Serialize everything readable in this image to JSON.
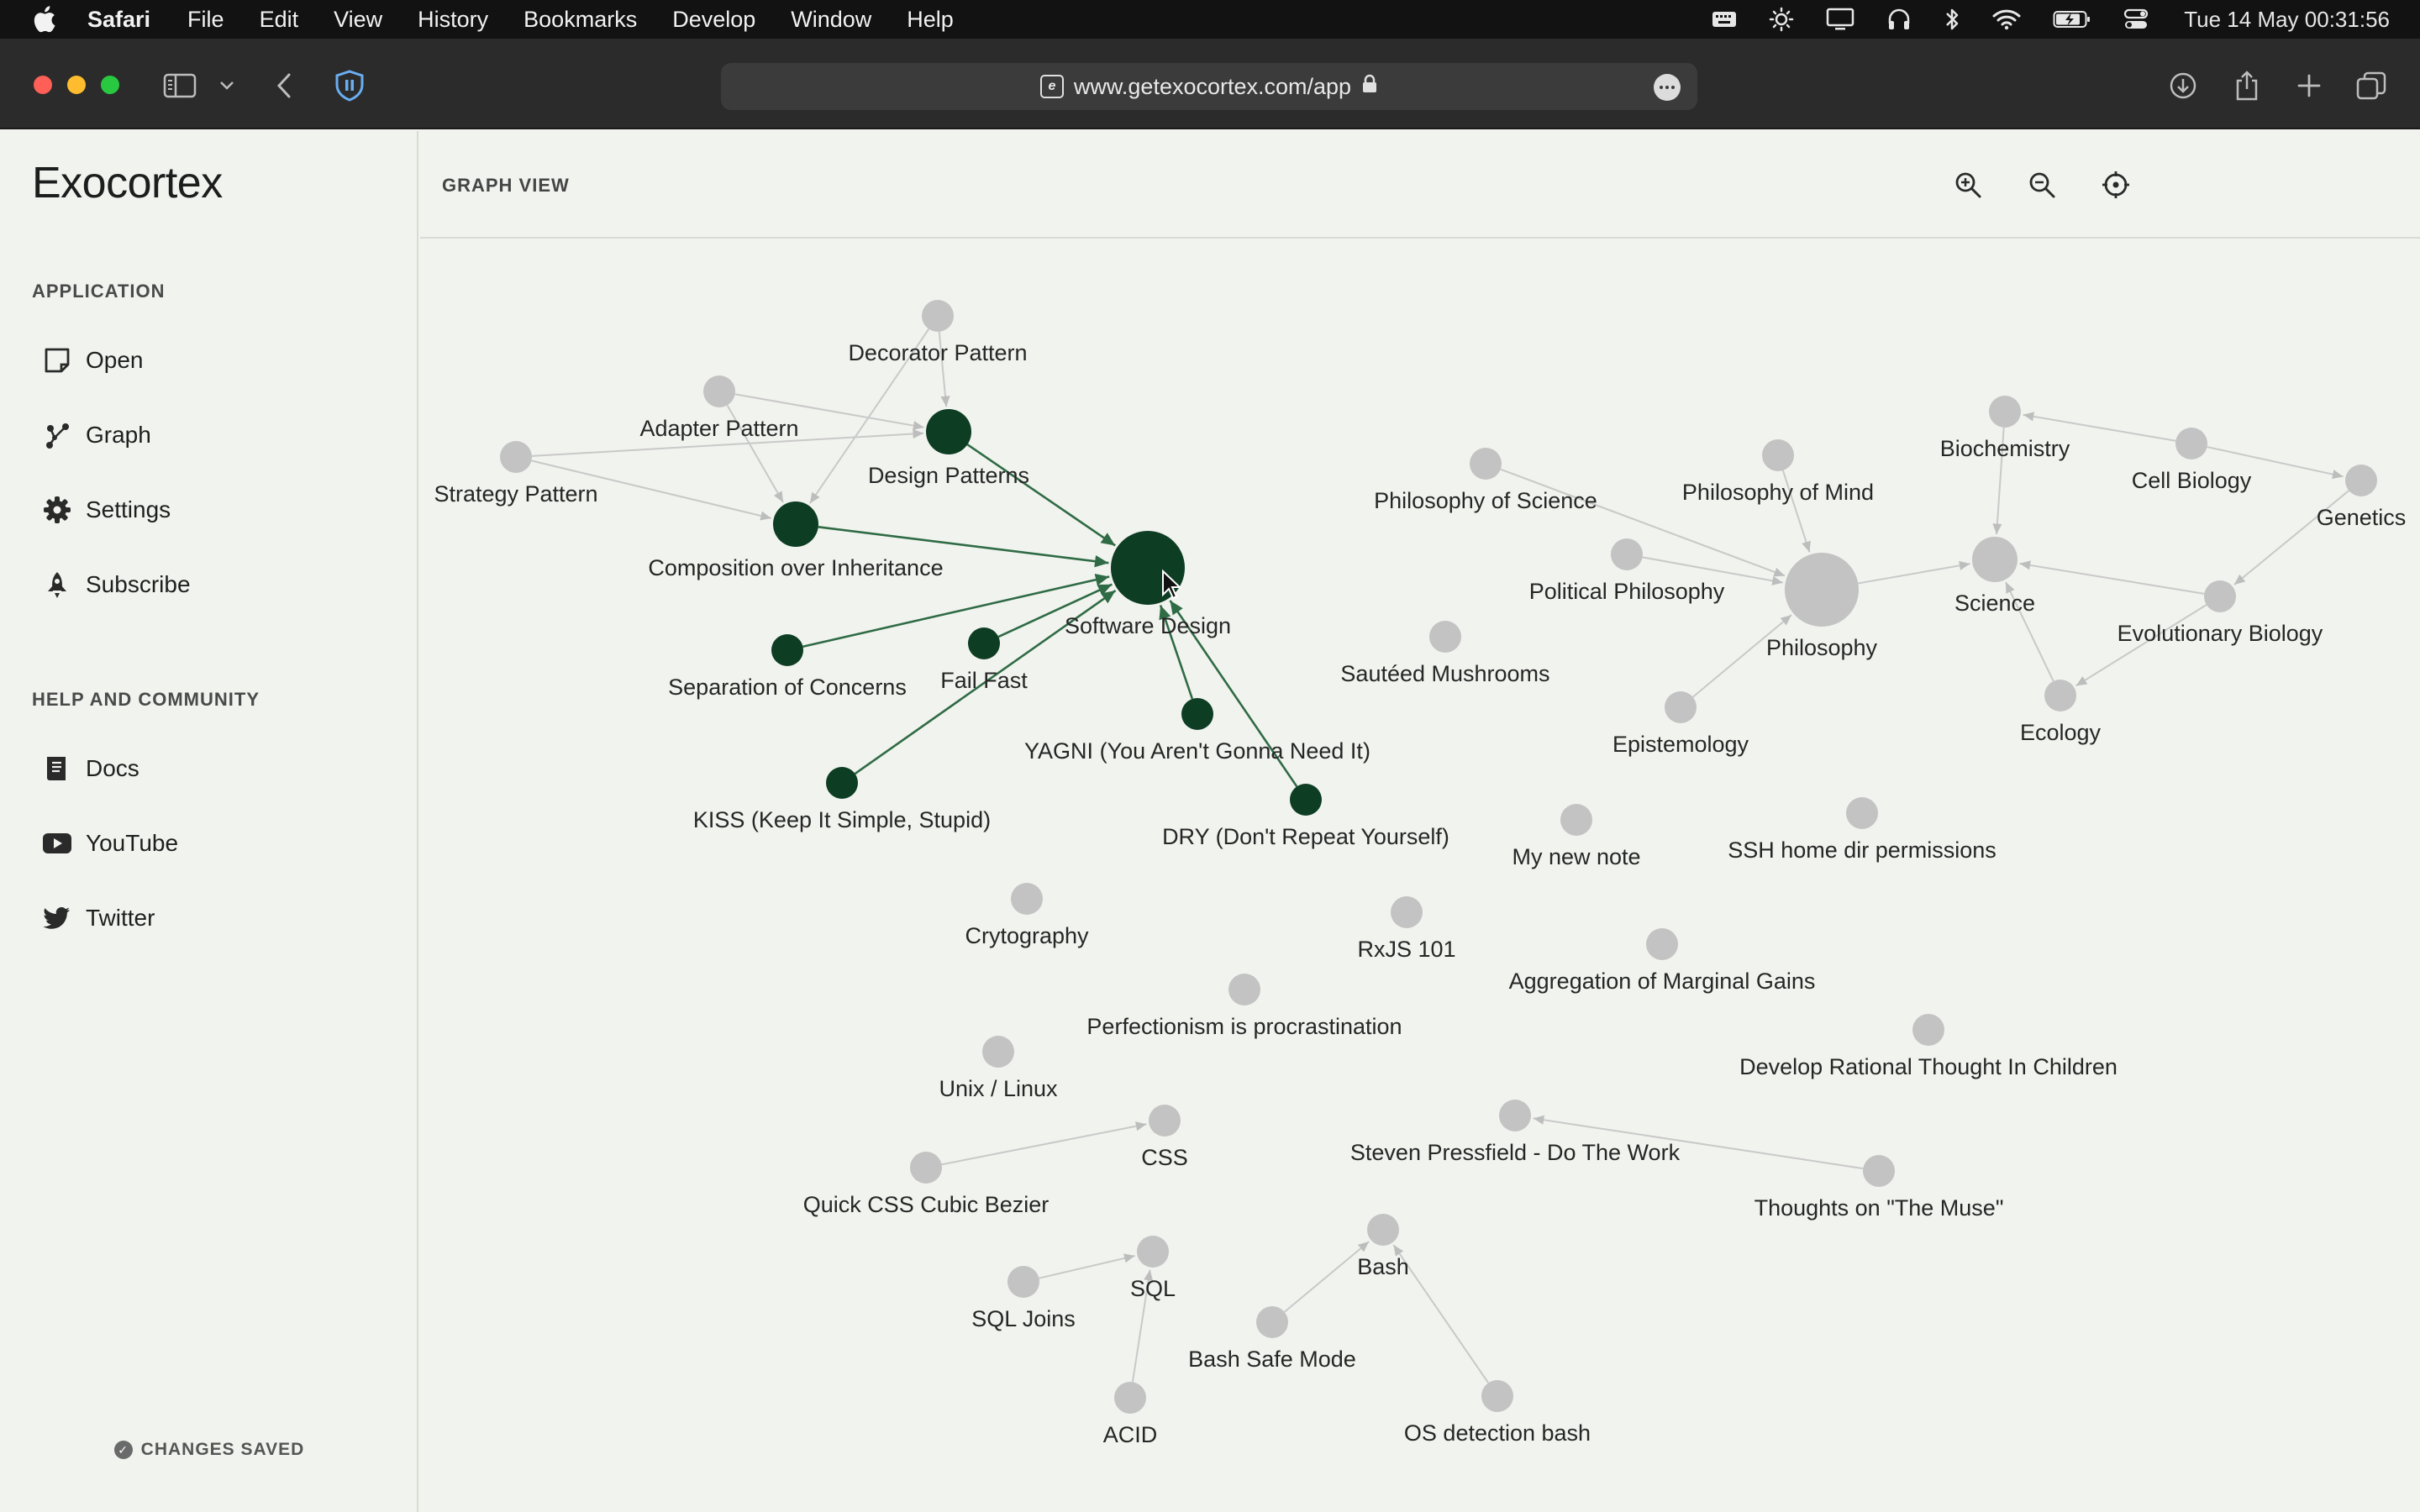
{
  "menubar": {
    "app_name": "Safari",
    "items": [
      "File",
      "Edit",
      "View",
      "History",
      "Bookmarks",
      "Develop",
      "Window",
      "Help"
    ],
    "clock": "Tue 14 May  00:31:56"
  },
  "browser": {
    "url": "www.getexocortex.com/app"
  },
  "sidebar": {
    "brand": "Exocortex",
    "application_title": "APPLICATION",
    "application_items": [
      {
        "label": "Open",
        "icon": "note-icon"
      },
      {
        "label": "Graph",
        "icon": "graph-icon"
      },
      {
        "label": "Settings",
        "icon": "gear-icon"
      },
      {
        "label": "Subscribe",
        "icon": "rocket-icon"
      }
    ],
    "help_title": "HELP AND COMMUNITY",
    "help_items": [
      {
        "label": "Docs",
        "icon": "book-icon"
      },
      {
        "label": "YouTube",
        "icon": "youtube-icon"
      },
      {
        "label": "Twitter",
        "icon": "twitter-icon"
      }
    ],
    "status": "CHANGES SAVED"
  },
  "main": {
    "title": "GRAPH VIEW"
  },
  "graph": {
    "colors": {
      "active": "#0d3d23",
      "inactive": "#c3c3c3",
      "edge_active": "#2f6b45",
      "edge_inactive": "#c9c9c9"
    },
    "nodes": [
      {
        "id": "software-design",
        "label": "Software Design",
        "active": true,
        "weight": 3
      },
      {
        "id": "decorator-pattern",
        "label": "Decorator Pattern",
        "active": false,
        "weight": 1
      },
      {
        "id": "adapter-pattern",
        "label": "Adapter Pattern",
        "active": false,
        "weight": 1
      },
      {
        "id": "design-patterns",
        "label": "Design Patterns",
        "active": true,
        "weight": 2
      },
      {
        "id": "strategy-pattern",
        "label": "Strategy Pattern",
        "active": false,
        "weight": 1
      },
      {
        "id": "composition",
        "label": "Composition over Inheritance",
        "active": true,
        "weight": 2
      },
      {
        "id": "separation",
        "label": "Separation of Concerns",
        "active": true,
        "weight": 1
      },
      {
        "id": "fail-fast",
        "label": "Fail Fast",
        "active": true,
        "weight": 1
      },
      {
        "id": "yagni",
        "label": "YAGNI (You Aren't Gonna Need It)",
        "active": true,
        "weight": 1
      },
      {
        "id": "kiss",
        "label": "KISS (Keep It Simple, Stupid)",
        "active": true,
        "weight": 1
      },
      {
        "id": "dry",
        "label": "DRY (Don't Repeat Yourself)",
        "active": true,
        "weight": 1
      },
      {
        "id": "philosophy-science",
        "label": "Philosophy of Science",
        "active": false,
        "weight": 1
      },
      {
        "id": "philosophy-mind",
        "label": "Philosophy of Mind",
        "active": false,
        "weight": 1
      },
      {
        "id": "political-philosophy",
        "label": "Political Philosophy",
        "active": false,
        "weight": 1
      },
      {
        "id": "philosophy",
        "label": "Philosophy",
        "active": false,
        "weight": 3
      },
      {
        "id": "epistemology",
        "label": "Epistemology",
        "active": false,
        "weight": 1
      },
      {
        "id": "science",
        "label": "Science",
        "active": false,
        "weight": 2
      },
      {
        "id": "biochemistry",
        "label": "Biochemistry",
        "active": false,
        "weight": 1
      },
      {
        "id": "cell-biology",
        "label": "Cell Biology",
        "active": false,
        "weight": 1
      },
      {
        "id": "genetics",
        "label": "Genetics",
        "active": false,
        "weight": 1
      },
      {
        "id": "evolutionary-biology",
        "label": "Evolutionary Biology",
        "active": false,
        "weight": 1
      },
      {
        "id": "ecology",
        "label": "Ecology",
        "active": false,
        "weight": 1
      },
      {
        "id": "sauteed-mushrooms",
        "label": "Sautéed Mushrooms",
        "active": false,
        "weight": 1
      },
      {
        "id": "my-new-note",
        "label": "My new note",
        "active": false,
        "weight": 1
      },
      {
        "id": "ssh-home",
        "label": "SSH home dir permissions",
        "active": false,
        "weight": 1
      },
      {
        "id": "crytography",
        "label": "Crytography",
        "active": false,
        "weight": 1
      },
      {
        "id": "rxjs",
        "label": "RxJS 101",
        "active": false,
        "weight": 1
      },
      {
        "id": "marginal-gains",
        "label": "Aggregation of Marginal Gains",
        "active": false,
        "weight": 1
      },
      {
        "id": "perfectionism",
        "label": "Perfectionism is procrastination",
        "active": false,
        "weight": 1
      },
      {
        "id": "rational-thought",
        "label": "Develop Rational Thought In Children",
        "active": false,
        "weight": 1
      },
      {
        "id": "unix-linux",
        "label": "Unix / Linux",
        "active": false,
        "weight": 1
      },
      {
        "id": "css",
        "label": "CSS",
        "active": false,
        "weight": 1
      },
      {
        "id": "quick-css",
        "label": "Quick CSS Cubic Bezier",
        "active": false,
        "weight": 1
      },
      {
        "id": "pressfield",
        "label": "Steven Pressfield - Do The Work",
        "active": false,
        "weight": 1
      },
      {
        "id": "the-muse",
        "label": "Thoughts on \"The Muse\"",
        "active": false,
        "weight": 1
      },
      {
        "id": "sql",
        "label": "SQL",
        "active": false,
        "weight": 1
      },
      {
        "id": "sql-joins",
        "label": "SQL Joins",
        "active": false,
        "weight": 1
      },
      {
        "id": "acid",
        "label": "ACID",
        "active": false,
        "weight": 1
      },
      {
        "id": "bash",
        "label": "Bash",
        "active": false,
        "weight": 1
      },
      {
        "id": "bash-safe-mode",
        "label": "Bash Safe Mode",
        "active": false,
        "weight": 1
      },
      {
        "id": "os-detection",
        "label": "OS detection bash",
        "active": false,
        "weight": 1
      }
    ],
    "edges": [
      {
        "from": "decorator-pattern",
        "to": "design-patterns"
      },
      {
        "from": "decorator-pattern",
        "to": "composition"
      },
      {
        "from": "adapter-pattern",
        "to": "design-patterns"
      },
      {
        "from": "adapter-pattern",
        "to": "composition"
      },
      {
        "from": "strategy-pattern",
        "to": "design-patterns"
      },
      {
        "from": "strategy-pattern",
        "to": "composition"
      },
      {
        "from": "design-patterns",
        "to": "software-design",
        "active": true
      },
      {
        "from": "composition",
        "to": "software-design",
        "active": true
      },
      {
        "from": "separation",
        "to": "software-design",
        "active": true
      },
      {
        "from": "fail-fast",
        "to": "software-design",
        "active": true
      },
      {
        "from": "kiss",
        "to": "software-design",
        "active": true
      },
      {
        "from": "yagni",
        "to": "software-design",
        "active": true
      },
      {
        "from": "dry",
        "to": "software-design",
        "active": true
      },
      {
        "from": "philosophy-science",
        "to": "philosophy"
      },
      {
        "from": "philosophy-mind",
        "to": "philosophy"
      },
      {
        "from": "political-philosophy",
        "to": "philosophy"
      },
      {
        "from": "epistemology",
        "to": "philosophy"
      },
      {
        "from": "philosophy",
        "to": "science"
      },
      {
        "from": "biochemistry",
        "to": "science"
      },
      {
        "from": "cell-biology",
        "to": "biochemistry"
      },
      {
        "from": "cell-biology",
        "to": "genetics"
      },
      {
        "from": "genetics",
        "to": "evolutionary-biology"
      },
      {
        "from": "evolutionary-biology",
        "to": "science"
      },
      {
        "from": "evolutionary-biology",
        "to": "ecology"
      },
      {
        "from": "ecology",
        "to": "science"
      },
      {
        "from": "quick-css",
        "to": "css"
      },
      {
        "from": "the-muse",
        "to": "pressfield"
      },
      {
        "from": "sql-joins",
        "to": "sql"
      },
      {
        "from": "acid",
        "to": "sql"
      },
      {
        "from": "bash-safe-mode",
        "to": "bash"
      },
      {
        "from": "os-detection",
        "to": "bash"
      }
    ]
  }
}
